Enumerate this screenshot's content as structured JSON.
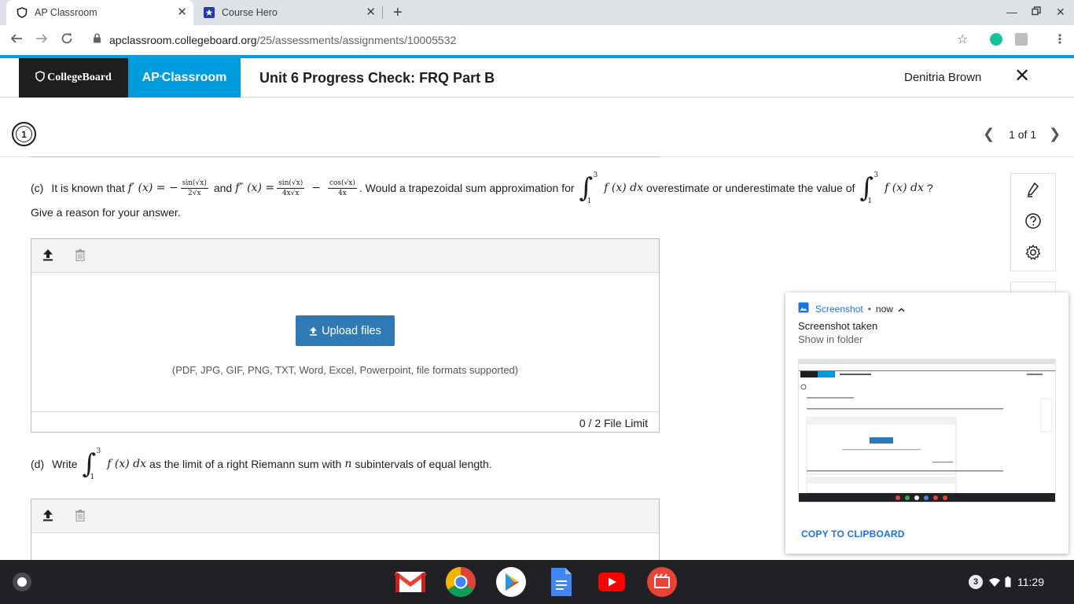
{
  "browser": {
    "tabs": [
      {
        "title": "AP Classroom",
        "active": true
      },
      {
        "title": "Course Hero",
        "active": false
      }
    ],
    "new_tab_label": "+",
    "url_host": "apclassroom.collegeboard.org",
    "url_path": "/25/assessments/assignments/10005532"
  },
  "header": {
    "cb_logo": "CollegeBoard",
    "apc_logo_ap": "AP",
    "apc_logo_rest": "Classroom",
    "title": "Unit 6 Progress Check: FRQ Part B",
    "user": "Denitria Brown"
  },
  "question_bar": {
    "number": "1",
    "pager": "1 of 1"
  },
  "part_c": {
    "label": "(c)",
    "intro": "It is known that",
    "and": "and",
    "would": ". Would a trapezoidal sum approximation for",
    "middle": "overestimate or underestimate the value of",
    "qmark": "?",
    "line2": "Give a reason for your answer.",
    "fprime": "f′ (x) = −",
    "fdouble": "f″ (x) =",
    "minus": "−",
    "frac1_num": "sin(√x)",
    "frac1_den": "2√x",
    "frac2_num": "sin(√x)",
    "frac2_den": "4x√x",
    "frac3_num": "cos(√x)",
    "frac3_den": "4x",
    "integral_upper": "3",
    "integral_lower": "1",
    "integrand": "f (x) dx"
  },
  "answer_box_c": {
    "upload_button": "Upload files",
    "formats": "(PDF, JPG, GIF, PNG, TXT, Word, Excel, Powerpoint, file formats supported)",
    "file_limit": "0 / 2 File Limit"
  },
  "part_d": {
    "label": "(d)",
    "write": "Write",
    "rest": "as the limit of a right Riemann sum with",
    "n": "n",
    "tail": "subintervals of equal length.",
    "integral_upper": "3",
    "integral_lower": "1",
    "integrand": "f (x) dx"
  },
  "notification": {
    "app": "Screenshot",
    "dot": "•",
    "time": "now",
    "title": "Screenshot taken",
    "subtitle": "Show in folder",
    "action": "COPY TO CLIPBOARD"
  },
  "shelf": {
    "badge": "3",
    "time": "11:29"
  },
  "colors": {
    "ap_blue": "#009cde",
    "upload_blue": "#2f7ab5",
    "chrome_blue": "#1a73e8",
    "shelf": "#202124"
  }
}
